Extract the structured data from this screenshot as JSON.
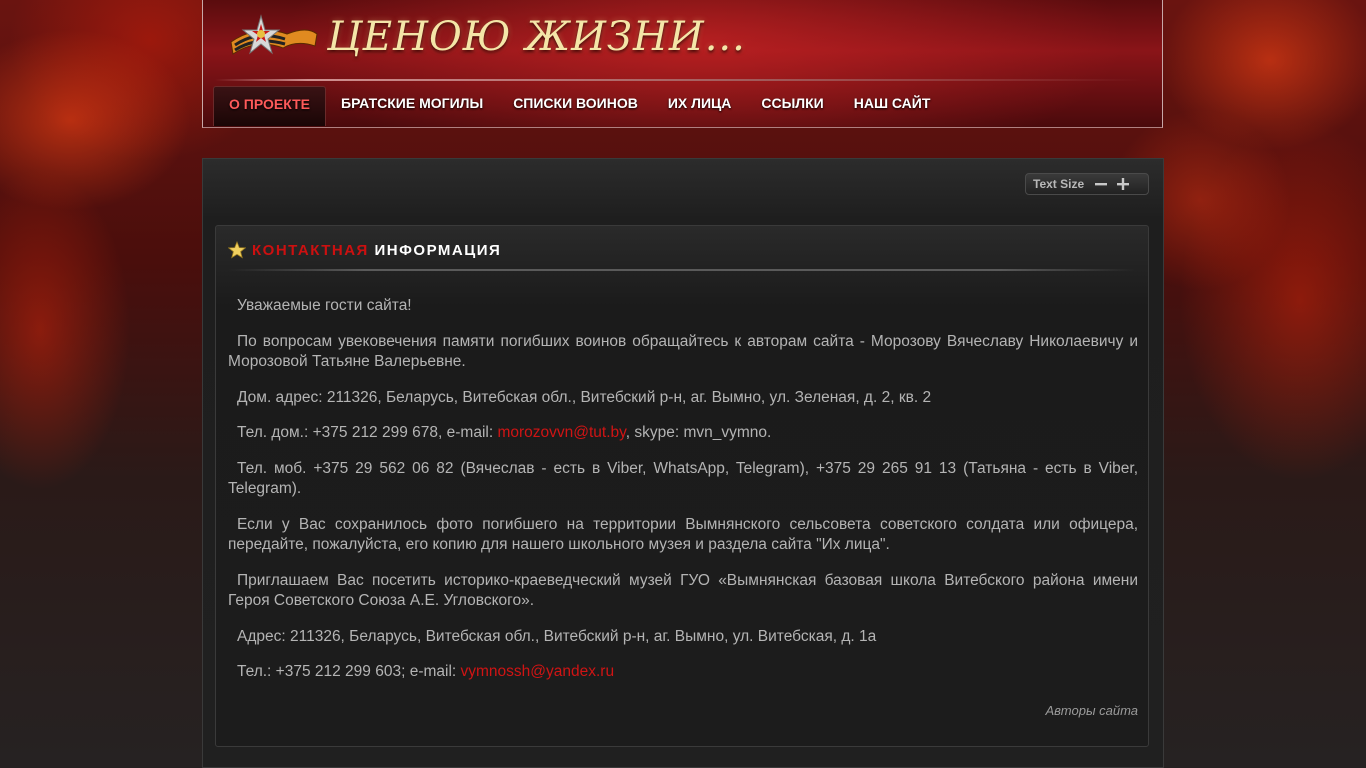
{
  "header": {
    "site_title": "ЦЕНОЮ ЖИЗНИ...",
    "nav": [
      {
        "label": "О ПРОЕКТЕ",
        "active": true
      },
      {
        "label": "БРАТСКИЕ МОГИЛЫ"
      },
      {
        "label": "СПИСКИ ВОИНОВ"
      },
      {
        "label": "ИХ ЛИЦА"
      },
      {
        "label": "ССЫЛКИ"
      },
      {
        "label": "НАШ САЙТ"
      }
    ]
  },
  "toolbar": {
    "text_size_label": "Text Size",
    "decrease_icon": "minus-icon",
    "increase_icon": "plus-icon"
  },
  "article": {
    "title_accent": "КОНТАКТНАЯ",
    "title_rest": "ИНФОРМАЦИЯ",
    "p1": "Уважаемые гости сайта!",
    "p2": "По вопросам увековечения памяти погибших воинов обращайтесь к авторам сайта - Морозову Вячеславу Николаевичу и Морозовой Татьяне Валерьевне.",
    "p3": "Дом. адрес: 211326,  Беларусь, Витебская обл., Витебский р-н, аг. Вымно, ул. Зеленая, д. 2, кв. 2",
    "p4_before": "Тел. дом.: +375 212 299 678, e-mail:  ",
    "p4_email": "morozovvn@tut.by",
    "p4_after": ", skype: mvn_vymno.",
    "p5": "Тел. моб. +375 29 562 06 82 (Вячеслав - есть в Viber, WhatsApp, Telegram), +375 29 265 91 13 (Татьяна - есть в Viber, Telegram).",
    "p6": "Если у Вас сохранилось фото погибшего на территории Вымнянского сельсовета советского солдата или офицера, передайте, пожалуйста, его копию для нашего школьного музея и раздела сайта \"Их лица\".",
    "p7": "Приглашаем Вас посетить историко-краеведческий музей ГУО «Вымнянская базовая школа Витебского района имени Героя Советского Союза А.Е. Угловского».",
    "p8": "Адрес: 211326,  Беларусь, Витебская обл., Витебский р-н, аг. Вымно, ул. Витебская, д. 1а",
    "p9_before": "Тел.:  +375 212 299 603; e-mail: ",
    "p9_email": "vymnossh@yandex.ru",
    "signature": "Авторы сайта"
  },
  "colors": {
    "accent": "#cc1010",
    "title_gold": "#f4e6a8",
    "body_text": "#b4b4b4"
  }
}
